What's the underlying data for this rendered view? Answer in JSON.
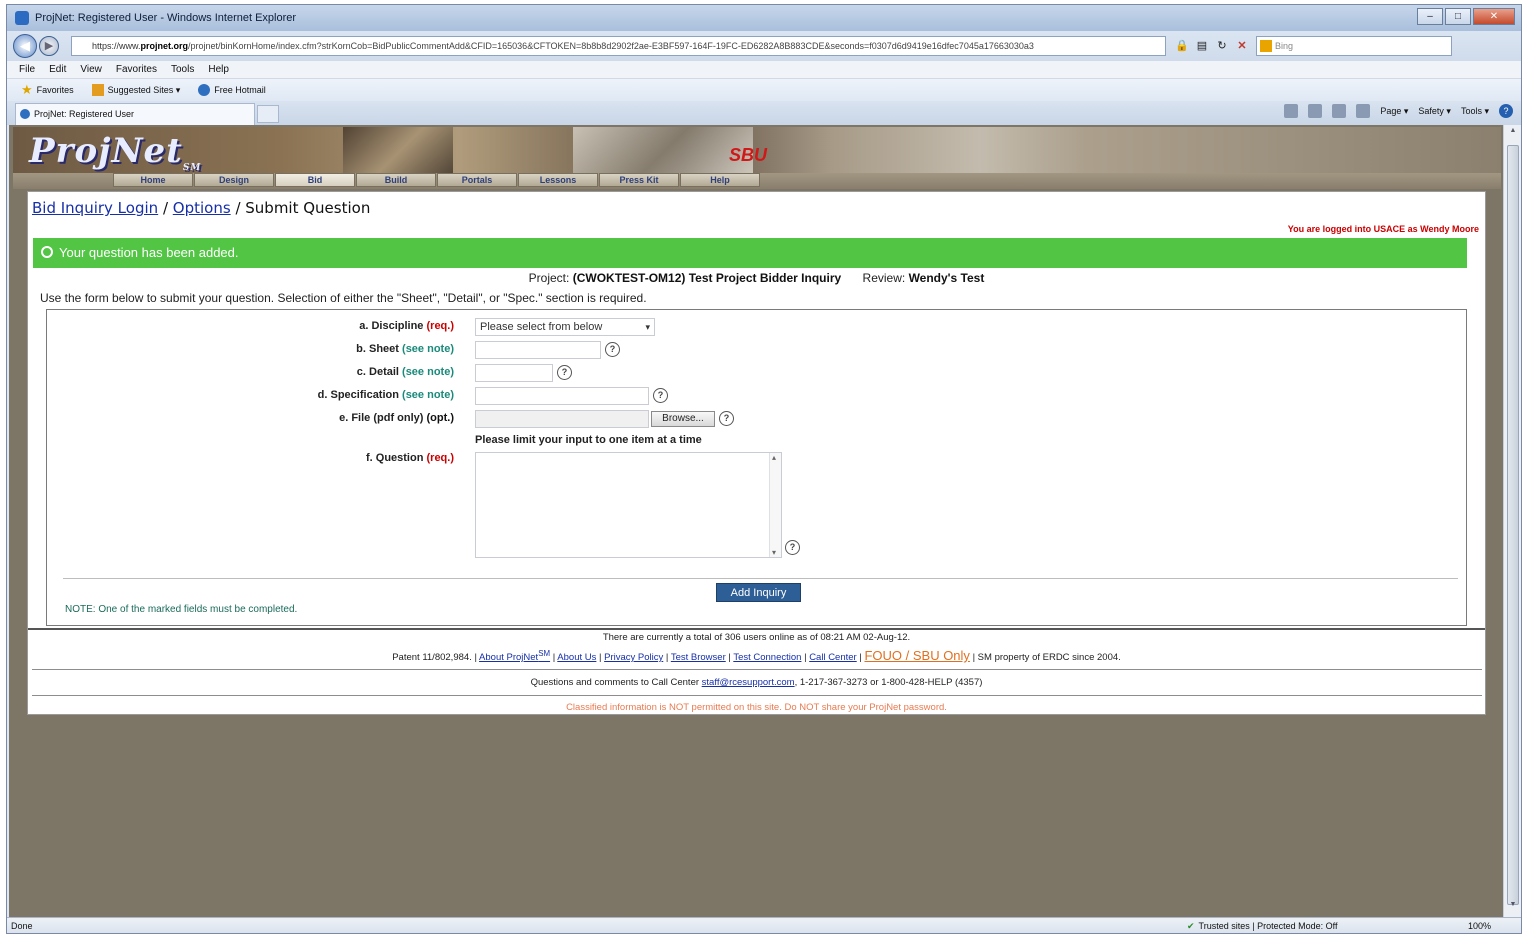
{
  "browser": {
    "title": "ProjNet: Registered User - Windows Internet Explorer",
    "url_scheme": "https://www.",
    "url_host": "projnet.org",
    "url_rest": "/projnet/binKornHome/index.cfm?strKornCob=BidPublicCommentAdd&CFID=165036&CFTOKEN=8b8b8d2902f2ae-E3BF597-164F-19FC-ED6282A8B883CDE&seconds=f0307d6d9419e16dfec7045a17663030a3",
    "search_placeholder": "Bing",
    "menu": [
      "File",
      "Edit",
      "View",
      "Favorites",
      "Tools",
      "Help"
    ],
    "favorites_label": "Favorites",
    "fav_items": [
      "Suggested Sites ▾",
      "Free Hotmail"
    ],
    "tab_title": "ProjNet: Registered User",
    "cmd": [
      "Page ▾",
      "Safety ▾",
      "Tools ▾"
    ],
    "status_left": "Done",
    "status_zone": "Trusted sites | Protected Mode: Off",
    "zoom": "100%"
  },
  "site": {
    "logo": "ProjNet",
    "logo_tm": "SM",
    "sbu": "SBU",
    "nav": [
      "Home",
      "Design",
      "Bid",
      "Build",
      "Portals",
      "Lessons",
      "Press Kit",
      "Help"
    ]
  },
  "page": {
    "crumb1": "Bid Inquiry Login",
    "crumb2": "Options",
    "crumb3": "Submit Question",
    "logged_in": "You are logged into USACE as Wendy Moore",
    "success": "Your question has been added.",
    "project_label": "Project:",
    "project_value": "(CWOKTEST-OM12) Test Project Bidder Inquiry",
    "review_label": "Review:",
    "review_value": "Wendy's Test",
    "instructions": "Use the form below to submit your question. Selection of either the \"Sheet\", \"Detail\", or \"Spec.\" section is required."
  },
  "form": {
    "discipline_label": "a. Discipline",
    "discipline_req": "(req.)",
    "discipline_value": "Please select from below",
    "sheet_label": "b. Sheet",
    "sheet_note": "(see note)",
    "detail_label": "c. Detail",
    "detail_note": "(see note)",
    "spec_label": "d. Specification",
    "spec_note": "(see note)",
    "file_label": "e. File (pdf only)",
    "file_opt": "(opt.)",
    "browse": "Browse...",
    "limit": "Please limit your input to one item at a time",
    "question_label": "f. Question",
    "question_req": "(req.)",
    "submit": "Add Inquiry",
    "note": "NOTE: One of the marked fields must be completed."
  },
  "footer": {
    "online": "There are currently a total of 306 users online as of 08:21 AM 02-Aug-12.",
    "patent": "Patent 11/802,984. |",
    "about_projnet": "About ProjNet",
    "about_projnet_sup": "SM",
    "about_us": "About Us",
    "privacy": "Privacy Policy",
    "test_browser": "Test Browser",
    "test_connection": "Test Connection",
    "call_center": "Call Center",
    "fouo": "FOUO / SBU Only",
    "sm_property": "| SM property of ERDC since 2004.",
    "questions": "Questions and comments to Call Center",
    "email": "staff@rcesupport.com",
    "phones": ", 1-217-367-3273 or 1-800-428-HELP (4357)",
    "classified": "Classified information is NOT permitted on this site. Do NOT share your ProjNet password."
  }
}
